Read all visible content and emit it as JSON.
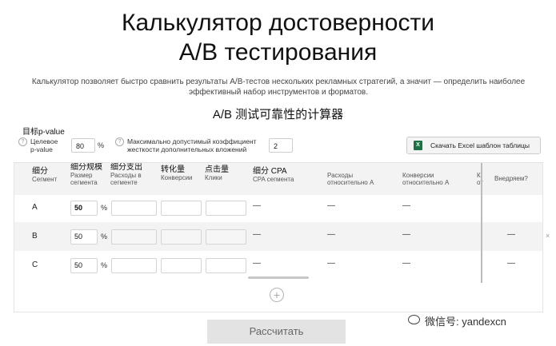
{
  "header": {
    "title_line1": "Калькулятор достоверности",
    "title_line2": "A/B тестирования",
    "description_line1": "Калькулятор позволяет быстро сравнить результаты A/B-тестов нескольких рекламных стратегий, а значит — определить наиболее",
    "description_line2": "эффективный набор инструментов и форматов.",
    "chinese_title": "A/B 测试可靠性的计算器"
  },
  "settings": {
    "cn_pvalue_label": "目标p-value",
    "pvalue_label_line1": "Целевое",
    "pvalue_label_line2": "p-value",
    "pvalue_value": "80",
    "pvalue_unit": "%",
    "coef_label_line1": "Максимально допустимый коэффициент",
    "coef_label_line2": "жесткости дополнительных вложений",
    "coef_value": "2",
    "excel_icon": "X",
    "excel_button": "Скачать Excel шаблон таблицы",
    "info_icon": "?"
  },
  "table": {
    "columns": [
      {
        "cn": "细分",
        "ru": "Сегмент",
        "ru2": ""
      },
      {
        "cn": "细分规模",
        "ru": "Размер",
        "ru2": "сегмента"
      },
      {
        "cn": "细分支出",
        "ru": "Расходы в",
        "ru2": "сегменте"
      },
      {
        "cn": "转化量",
        "ru": "Конверсии",
        "ru2": ""
      },
      {
        "cn": "点击量",
        "ru": "Клики",
        "ru2": ""
      },
      {
        "cn": "细分 CPA",
        "ru": "CPA сегмента",
        "ru2": ""
      },
      {
        "cn": "",
        "ru": "Расходы",
        "ru2": "относительно A"
      },
      {
        "cn": "",
        "ru": "Конверсии",
        "ru2": "относительно A"
      },
      {
        "cn": "",
        "ru": "К",
        "ru2": "от"
      },
      {
        "cn": "",
        "ru": "Внедряем?",
        "ru2": ""
      }
    ],
    "rows": [
      {
        "label": "A",
        "size": "50",
        "unit": "%",
        "cpa": "—",
        "rel_spend": "—",
        "rel_conv": "—",
        "deploy": ""
      },
      {
        "label": "B",
        "size": "50",
        "unit": "%",
        "cpa": "—",
        "rel_spend": "—",
        "rel_conv": "—",
        "deploy": "—"
      },
      {
        "label": "C",
        "size": "50",
        "unit": "%",
        "cpa": "—",
        "rel_spend": "—",
        "rel_conv": "—",
        "deploy": "—"
      }
    ],
    "add_icon": "+",
    "close_icon": "×"
  },
  "actions": {
    "calculate_label": "Рассчитать"
  },
  "watermark": {
    "text": "微信号: yandexcn"
  }
}
